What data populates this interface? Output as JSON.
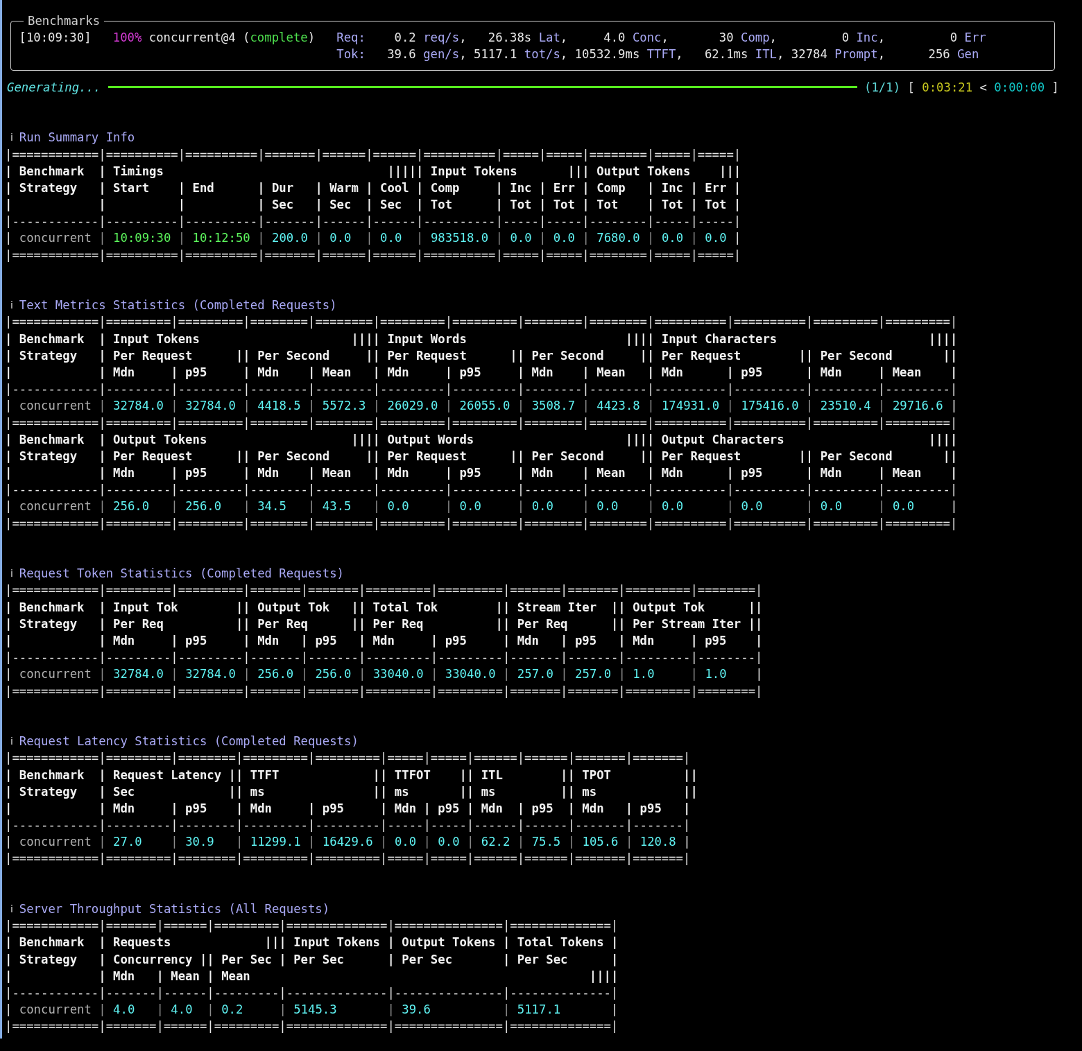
{
  "panel": {
    "title": "Benchmarks",
    "status": [
      {
        "text": "[10:09:30]",
        "kind": "stamp"
      },
      {
        "text": "100%",
        "kind": "percent"
      },
      {
        "text": " concurrent@4 (",
        "kind": "text"
      },
      {
        "text": "complete",
        "kind": "status"
      },
      {
        "text": ")",
        "kind": "text"
      }
    ],
    "stats": [
      [
        {
          "text": "Req:",
          "kind": "label"
        },
        {
          "text": "    0.2 ",
          "kind": "num"
        },
        {
          "text": "req/s",
          "kind": "label"
        },
        {
          "text": ",   26.38s ",
          "kind": "num"
        },
        {
          "text": "Lat",
          "kind": "label"
        },
        {
          "text": ",     4.0 ",
          "kind": "num"
        },
        {
          "text": "Conc",
          "kind": "label"
        },
        {
          "text": ",       30 ",
          "kind": "num"
        },
        {
          "text": "Comp",
          "kind": "label"
        },
        {
          "text": ",         0 ",
          "kind": "num"
        },
        {
          "text": "Inc",
          "kind": "label"
        },
        {
          "text": ",         0 ",
          "kind": "num"
        },
        {
          "text": "Err",
          "kind": "label"
        }
      ],
      [
        {
          "text": "Tok:",
          "kind": "label"
        },
        {
          "text": "   39.6 ",
          "kind": "num"
        },
        {
          "text": "gen/s",
          "kind": "label"
        },
        {
          "text": ", 5117.1 ",
          "kind": "num"
        },
        {
          "text": "tot/s",
          "kind": "label"
        },
        {
          "text": ", 10532.9ms ",
          "kind": "num"
        },
        {
          "text": "TTFT",
          "kind": "label"
        },
        {
          "text": ",   62.1ms ",
          "kind": "num"
        },
        {
          "text": "ITL",
          "kind": "label"
        },
        {
          "text": ", 32784 ",
          "kind": "num"
        },
        {
          "text": "Prompt",
          "kind": "label"
        },
        {
          "text": ",      256 ",
          "kind": "num"
        },
        {
          "text": "Gen",
          "kind": "label"
        }
      ]
    ]
  },
  "progress": {
    "label": "Generating...",
    "level": 1,
    "tail": [
      {
        "text": "(1/1)",
        "kind": "count"
      },
      {
        "text": " [ ",
        "kind": "text"
      },
      {
        "text": "0:03:21",
        "kind": "elapsed"
      },
      {
        "text": " < ",
        "kind": "text"
      },
      {
        "text": "0:00:00",
        "kind": "remaining"
      },
      {
        "text": " ]",
        "kind": "text"
      }
    ]
  },
  "sections": [
    {
      "marker": "ℹ",
      "title": "Run Summary Info",
      "lines": [
        {
          "kind": "rule",
          "text": "|============|==========|==========|=======|======|======|==========|=====|=====|========|=====|=====|"
        },
        {
          "kind": "header",
          "text": "| Benchmark  | Timings                               ||||| Input Tokens       ||| Output Tokens    |||"
        },
        {
          "kind": "header",
          "text": "| Strategy   | Start    | End      | Dur   | Warm | Cool | Comp     | Inc | Err | Comp   | Inc | Err |"
        },
        {
          "kind": "header",
          "text": "|            |          |          | Sec   | Sec  | Sec  | Tot      | Tot | Tot | Tot    | Tot | Tot |"
        },
        {
          "kind": "rule",
          "text": "|------------|----------|----------|-------|------|------|----------|-----|-----|--------|-----|-----|"
        },
        {
          "kind": "data",
          "segments": [
            {
              "text": "| ",
              "kind": "edge"
            },
            {
              "text": "concurrent",
              "kind": "strategy"
            },
            {
              "text": " | ",
              "kind": "sep"
            },
            {
              "text": "10:09:30",
              "kind": "time"
            },
            {
              "text": " | ",
              "kind": "sep"
            },
            {
              "text": "10:12:50",
              "kind": "time"
            },
            {
              "text": " | ",
              "kind": "sep"
            },
            {
              "text": "200.0",
              "kind": "value"
            },
            {
              "text": " | ",
              "kind": "sep"
            },
            {
              "text": "0.0",
              "kind": "value"
            },
            {
              "text": "  | ",
              "kind": "sep"
            },
            {
              "text": "0.0",
              "kind": "value"
            },
            {
              "text": "  | ",
              "kind": "sep"
            },
            {
              "text": "983518.0",
              "kind": "value"
            },
            {
              "text": " | ",
              "kind": "sep"
            },
            {
              "text": "0.0",
              "kind": "value"
            },
            {
              "text": " | ",
              "kind": "sep"
            },
            {
              "text": "0.0",
              "kind": "value"
            },
            {
              "text": " | ",
              "kind": "sep"
            },
            {
              "text": "7680.0",
              "kind": "value"
            },
            {
              "text": " | ",
              "kind": "sep"
            },
            {
              "text": "0.0",
              "kind": "value"
            },
            {
              "text": " | ",
              "kind": "sep"
            },
            {
              "text": "0.0",
              "kind": "value"
            },
            {
              "text": " |",
              "kind": "edge"
            }
          ]
        },
        {
          "kind": "rule",
          "text": "|============|==========|==========|=======|======|======|==========|=====|=====|========|=====|=====|"
        }
      ]
    },
    {
      "marker": "ℹ",
      "title": "Text Metrics Statistics (Completed Requests)",
      "lines": [
        {
          "kind": "rule",
          "text": "|============|=========|=========|========|========|=========|=========|========|========|==========|==========|=========|=========|"
        },
        {
          "kind": "header",
          "text": "| Benchmark  | Input Tokens                     |||| Input Words                      |||| Input Characters                     ||||"
        },
        {
          "kind": "header",
          "text": "| Strategy   | Per Request      || Per Second     || Per Request      || Per Second     || Per Request        || Per Second       ||"
        },
        {
          "kind": "header",
          "text": "|            | Mdn     | p95     | Mdn    | Mean   | Mdn     | p95     | Mdn    | Mean   | Mdn      | p95      | Mdn     | Mean    |"
        },
        {
          "kind": "rule",
          "text": "|------------|---------|---------|--------|--------|---------|---------|--------|--------|----------|----------|---------|---------|"
        },
        {
          "kind": "data",
          "segments": [
            {
              "text": "| ",
              "kind": "edge"
            },
            {
              "text": "concurrent",
              "kind": "strategy"
            },
            {
              "text": " | ",
              "kind": "sep"
            },
            {
              "text": "32784.0",
              "kind": "value"
            },
            {
              "text": " | ",
              "kind": "sep"
            },
            {
              "text": "32784.0",
              "kind": "value"
            },
            {
              "text": " | ",
              "kind": "sep"
            },
            {
              "text": "4418.5",
              "kind": "value"
            },
            {
              "text": " | ",
              "kind": "sep"
            },
            {
              "text": "5572.3",
              "kind": "value"
            },
            {
              "text": " | ",
              "kind": "sep"
            },
            {
              "text": "26029.0",
              "kind": "value"
            },
            {
              "text": " | ",
              "kind": "sep"
            },
            {
              "text": "26055.0",
              "kind": "value"
            },
            {
              "text": " | ",
              "kind": "sep"
            },
            {
              "text": "3508.7",
              "kind": "value"
            },
            {
              "text": " | ",
              "kind": "sep"
            },
            {
              "text": "4423.8",
              "kind": "value"
            },
            {
              "text": " | ",
              "kind": "sep"
            },
            {
              "text": "174931.0",
              "kind": "value"
            },
            {
              "text": " | ",
              "kind": "sep"
            },
            {
              "text": "175416.0",
              "kind": "value"
            },
            {
              "text": " | ",
              "kind": "sep"
            },
            {
              "text": "23510.4",
              "kind": "value"
            },
            {
              "text": " | ",
              "kind": "sep"
            },
            {
              "text": "29716.6",
              "kind": "value"
            },
            {
              "text": " |",
              "kind": "edge"
            }
          ]
        },
        {
          "kind": "rule",
          "text": "|============|=========|=========|========|========|=========|=========|========|========|==========|==========|=========|=========|"
        },
        {
          "kind": "header",
          "text": "| Benchmark  | Output Tokens                    |||| Output Words                     |||| Output Characters                    ||||"
        },
        {
          "kind": "header",
          "text": "| Strategy   | Per Request      || Per Second     || Per Request      || Per Second     || Per Request        || Per Second       ||"
        },
        {
          "kind": "header",
          "text": "|            | Mdn     | p95     | Mdn    | Mean   | Mdn     | p95     | Mdn    | Mean   | Mdn      | p95      | Mdn     | Mean    |"
        },
        {
          "kind": "rule",
          "text": "|------------|---------|---------|--------|--------|---------|---------|--------|--------|----------|----------|---------|---------|"
        },
        {
          "kind": "data",
          "segments": [
            {
              "text": "| ",
              "kind": "edge"
            },
            {
              "text": "concurrent",
              "kind": "strategy"
            },
            {
              "text": " | ",
              "kind": "sep"
            },
            {
              "text": "256.0",
              "kind": "value"
            },
            {
              "text": "   | ",
              "kind": "sep"
            },
            {
              "text": "256.0",
              "kind": "value"
            },
            {
              "text": "   | ",
              "kind": "sep"
            },
            {
              "text": "34.5",
              "kind": "value"
            },
            {
              "text": "   | ",
              "kind": "sep"
            },
            {
              "text": "43.5",
              "kind": "value"
            },
            {
              "text": "   | ",
              "kind": "sep"
            },
            {
              "text": "0.0",
              "kind": "value"
            },
            {
              "text": "     | ",
              "kind": "sep"
            },
            {
              "text": "0.0",
              "kind": "value"
            },
            {
              "text": "     | ",
              "kind": "sep"
            },
            {
              "text": "0.0",
              "kind": "value"
            },
            {
              "text": "    | ",
              "kind": "sep"
            },
            {
              "text": "0.0",
              "kind": "value"
            },
            {
              "text": "    | ",
              "kind": "sep"
            },
            {
              "text": "0.0",
              "kind": "value"
            },
            {
              "text": "      | ",
              "kind": "sep"
            },
            {
              "text": "0.0",
              "kind": "value"
            },
            {
              "text": "      | ",
              "kind": "sep"
            },
            {
              "text": "0.0",
              "kind": "value"
            },
            {
              "text": "     | ",
              "kind": "sep"
            },
            {
              "text": "0.0",
              "kind": "value"
            },
            {
              "text": "     |",
              "kind": "edge"
            }
          ]
        },
        {
          "kind": "rule",
          "text": "|============|=========|=========|========|========|=========|=========|========|========|==========|==========|=========|=========|"
        }
      ]
    },
    {
      "marker": "ℹ",
      "title": "Request Token Statistics (Completed Requests)",
      "lines": [
        {
          "kind": "rule",
          "text": "|============|=========|=========|=======|=======|=========|=========|=======|=======|=========|========|"
        },
        {
          "kind": "header",
          "text": "| Benchmark  | Input Tok        || Output Tok   || Total Tok        || Stream Iter  || Output Tok      ||"
        },
        {
          "kind": "header",
          "text": "| Strategy   | Per Req          || Per Req      || Per Req          || Per Req      || Per Stream Iter ||"
        },
        {
          "kind": "header",
          "text": "|            | Mdn     | p95     | Mdn   | p95   | Mdn     | p95     | Mdn   | p95   | Mdn     | p95    |"
        },
        {
          "kind": "rule",
          "text": "|------------|---------|---------|-------|-------|---------|---------|-------|-------|---------|--------|"
        },
        {
          "kind": "data",
          "segments": [
            {
              "text": "| ",
              "kind": "edge"
            },
            {
              "text": "concurrent",
              "kind": "strategy"
            },
            {
              "text": " | ",
              "kind": "sep"
            },
            {
              "text": "32784.0",
              "kind": "value"
            },
            {
              "text": " | ",
              "kind": "sep"
            },
            {
              "text": "32784.0",
              "kind": "value"
            },
            {
              "text": " | ",
              "kind": "sep"
            },
            {
              "text": "256.0",
              "kind": "value"
            },
            {
              "text": " | ",
              "kind": "sep"
            },
            {
              "text": "256.0",
              "kind": "value"
            },
            {
              "text": " | ",
              "kind": "sep"
            },
            {
              "text": "33040.0",
              "kind": "value"
            },
            {
              "text": " | ",
              "kind": "sep"
            },
            {
              "text": "33040.0",
              "kind": "value"
            },
            {
              "text": " | ",
              "kind": "sep"
            },
            {
              "text": "257.0",
              "kind": "value"
            },
            {
              "text": " | ",
              "kind": "sep"
            },
            {
              "text": "257.0",
              "kind": "value"
            },
            {
              "text": " | ",
              "kind": "sep"
            },
            {
              "text": "1.0",
              "kind": "value"
            },
            {
              "text": "     | ",
              "kind": "sep"
            },
            {
              "text": "1.0",
              "kind": "value"
            },
            {
              "text": "    |",
              "kind": "edge"
            }
          ]
        },
        {
          "kind": "rule",
          "text": "|============|=========|=========|=======|=======|=========|=========|=======|=======|=========|========|"
        }
      ]
    },
    {
      "marker": "ℹ",
      "title": "Request Latency Statistics (Completed Requests)",
      "lines": [
        {
          "kind": "rule",
          "text": "|============|=========|========|=========|=========|=====|=====|======|======|=======|=======|"
        },
        {
          "kind": "header",
          "text": "| Benchmark  | Request Latency || TTFT             || TTFOT    || ITL        || TPOT          ||"
        },
        {
          "kind": "header",
          "text": "| Strategy   | Sec             || ms               || ms       || ms         || ms            ||"
        },
        {
          "kind": "header",
          "text": "|            | Mdn     | p95    | Mdn     | p95     | Mdn | p95 | Mdn  | p95  | Mdn   | p95   |"
        },
        {
          "kind": "rule",
          "text": "|------------|---------|--------|---------|---------|-----|-----|------|------|-------|-------|"
        },
        {
          "kind": "data",
          "segments": [
            {
              "text": "| ",
              "kind": "edge"
            },
            {
              "text": "concurrent",
              "kind": "strategy"
            },
            {
              "text": " | ",
              "kind": "sep"
            },
            {
              "text": "27.0",
              "kind": "value"
            },
            {
              "text": "    | ",
              "kind": "sep"
            },
            {
              "text": "30.9",
              "kind": "value"
            },
            {
              "text": "   | ",
              "kind": "sep"
            },
            {
              "text": "11299.1",
              "kind": "value"
            },
            {
              "text": " | ",
              "kind": "sep"
            },
            {
              "text": "16429.6",
              "kind": "value"
            },
            {
              "text": " | ",
              "kind": "sep"
            },
            {
              "text": "0.0",
              "kind": "value"
            },
            {
              "text": " | ",
              "kind": "sep"
            },
            {
              "text": "0.0",
              "kind": "value"
            },
            {
              "text": " | ",
              "kind": "sep"
            },
            {
              "text": "62.2",
              "kind": "value"
            },
            {
              "text": " | ",
              "kind": "sep"
            },
            {
              "text": "75.5",
              "kind": "value"
            },
            {
              "text": " | ",
              "kind": "sep"
            },
            {
              "text": "105.6",
              "kind": "value"
            },
            {
              "text": " | ",
              "kind": "sep"
            },
            {
              "text": "120.8",
              "kind": "value"
            },
            {
              "text": " |",
              "kind": "edge"
            }
          ]
        },
        {
          "kind": "rule",
          "text": "|============|=========|========|=========|=========|=====|=====|======|======|=======|=======|"
        }
      ]
    },
    {
      "marker": "ℹ",
      "title": "Server Throughput Statistics (All Requests)",
      "lines": [
        {
          "kind": "rule",
          "text": "|============|=======|======|=========|==============|===============|==============|"
        },
        {
          "kind": "header",
          "text": "| Benchmark  | Requests             ||| Input Tokens | Output Tokens | Total Tokens |"
        },
        {
          "kind": "header",
          "text": "| Strategy   | Concurrency || Per Sec | Per Sec      | Per Sec       | Per Sec      |"
        },
        {
          "kind": "header",
          "text": "|            | Mdn   | Mean | Mean                                               ||||"
        },
        {
          "kind": "rule",
          "text": "|------------|-------|------|---------|--------------|---------------|--------------|"
        },
        {
          "kind": "data",
          "segments": [
            {
              "text": "| ",
              "kind": "edge"
            },
            {
              "text": "concurrent",
              "kind": "strategy"
            },
            {
              "text": " | ",
              "kind": "sep"
            },
            {
              "text": "4.0",
              "kind": "value"
            },
            {
              "text": "   | ",
              "kind": "sep"
            },
            {
              "text": "4.0",
              "kind": "value"
            },
            {
              "text": "  | ",
              "kind": "sep"
            },
            {
              "text": "0.2",
              "kind": "value"
            },
            {
              "text": "     | ",
              "kind": "sep"
            },
            {
              "text": "5145.3",
              "kind": "value"
            },
            {
              "text": "       | ",
              "kind": "sep"
            },
            {
              "text": "39.6",
              "kind": "value"
            },
            {
              "text": "          | ",
              "kind": "sep"
            },
            {
              "text": "5117.1",
              "kind": "value"
            },
            {
              "text": "       |",
              "kind": "edge"
            }
          ]
        },
        {
          "kind": "rule",
          "text": "|============|=======|======|=========|==============|===============|==============|"
        }
      ]
    }
  ]
}
